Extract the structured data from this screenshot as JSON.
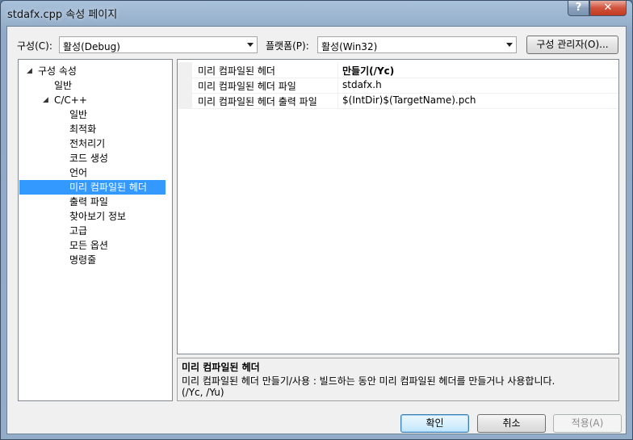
{
  "window": {
    "title": "stdafx.cpp 속성 페이지",
    "help_label": "?",
    "close_label": "✕"
  },
  "config": {
    "label": "구성(C):",
    "value": "활성(Debug)",
    "platform_label": "플랫폼(P):",
    "platform_value": "활성(Win32)",
    "manager_button": "구성 관리자(O)..."
  },
  "tree": {
    "items": [
      {
        "label": "구성 속성",
        "expander": "◢"
      },
      {
        "label": "일반"
      },
      {
        "label": "C/C++",
        "expander": "◢"
      },
      {
        "label": "일반"
      },
      {
        "label": "최적화"
      },
      {
        "label": "전처리기"
      },
      {
        "label": "코드 생성"
      },
      {
        "label": "언어"
      },
      {
        "label": "미리 컴파일된 헤더"
      },
      {
        "label": "출력 파일"
      },
      {
        "label": "찾아보기 정보"
      },
      {
        "label": "고급"
      },
      {
        "label": "모든 옵션"
      },
      {
        "label": "명령줄"
      }
    ]
  },
  "grid": {
    "rows": [
      {
        "name": "미리 컴파일된 헤더",
        "value": "만들기(/Yc)"
      },
      {
        "name": "미리 컴파일된 헤더 파일",
        "value": "stdafx.h"
      },
      {
        "name": "미리 컴파일된 헤더 출력 파일",
        "value": "$(IntDir)$(TargetName).pch"
      }
    ]
  },
  "description": {
    "title": "미리 컴파일된 헤더",
    "body": "미리 컴파일된 헤더 만들기/사용 : 빌드하는 동안 미리 컴파일된 헤더를 만들거나 사용합니다.",
    "body2": "(/Yc, /Yu)"
  },
  "buttons": {
    "ok": "확인",
    "cancel": "취소",
    "apply": "적용(A)"
  }
}
